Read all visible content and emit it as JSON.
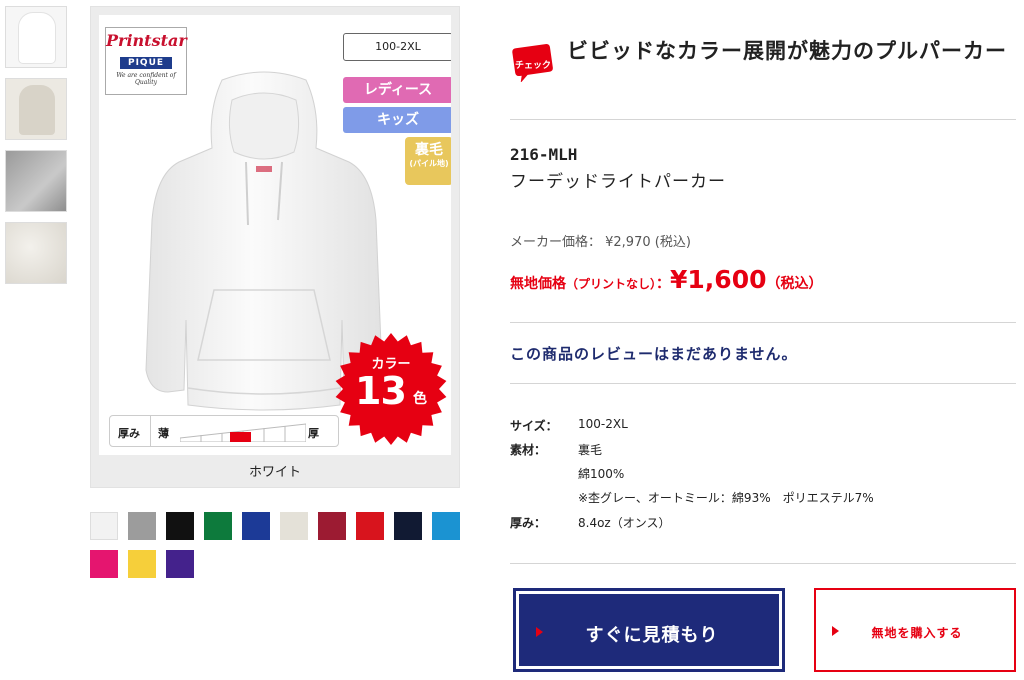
{
  "product": {
    "logo": {
      "brand": "Printstar",
      "line": "PIQUE",
      "tagline": "We are confident of Quality"
    },
    "size_badge": "100-2XL",
    "tags": {
      "ladies": "レディース",
      "kids": "キッズ",
      "fabric_big": "裏毛",
      "fabric_small": "(パイル地)"
    },
    "color_burst": {
      "label": "カラー",
      "count": "13",
      "unit": "色"
    },
    "thickness": {
      "label": "厚み",
      "thin": "薄",
      "thick": "厚",
      "level": "4/6"
    },
    "selected_color": "ホワイト",
    "swatches": [
      {
        "name": "white",
        "color": "#f2f2f2"
      },
      {
        "name": "gray",
        "color": "#9c9c9c"
      },
      {
        "name": "black",
        "color": "#111111"
      },
      {
        "name": "green",
        "color": "#0d7a3c"
      },
      {
        "name": "royal-blue",
        "color": "#1c3a97"
      },
      {
        "name": "oatmeal",
        "color": "#e4e1d8"
      },
      {
        "name": "burgundy",
        "color": "#9c1b32"
      },
      {
        "name": "red",
        "color": "#d8141d"
      },
      {
        "name": "navy",
        "color": "#111a33"
      },
      {
        "name": "turquoise",
        "color": "#1b93d2"
      },
      {
        "name": "pink",
        "color": "#e5156f"
      },
      {
        "name": "yellow",
        "color": "#f6cf3a"
      },
      {
        "name": "purple",
        "color": "#44228c"
      }
    ]
  },
  "info": {
    "badge": "チェック",
    "headline": "ビビッドなカラー展開が魅力のプルパーカー",
    "code": "216-MLH",
    "name": "フーデッドライトパーカー",
    "maker_price": "メーカー価格： ¥2,970 (税込)",
    "price_label": "無地価格",
    "price_note": "（プリントなし）",
    "price_colon": "：",
    "price_value": "¥1,600",
    "price_tax": "（税込）",
    "review_text": "この商品のレビューはまだありません。",
    "specs": {
      "size_key": "サイズ：",
      "size_val": "100-2XL",
      "material_key": "素材：",
      "material_val1": "裏毛",
      "material_val2": "綿100%",
      "material_val3": "※杢グレー、オートミール：綿93%　ポリエステル7%",
      "thickness_key": "厚み：",
      "thickness_val": "8.4oz（オンス）"
    }
  },
  "actions": {
    "estimate": "すぐに見積もり",
    "buy_plain": "無地を購入する"
  },
  "colors": {
    "accent_red": "#e60012",
    "navy": "#1e2a7a"
  }
}
